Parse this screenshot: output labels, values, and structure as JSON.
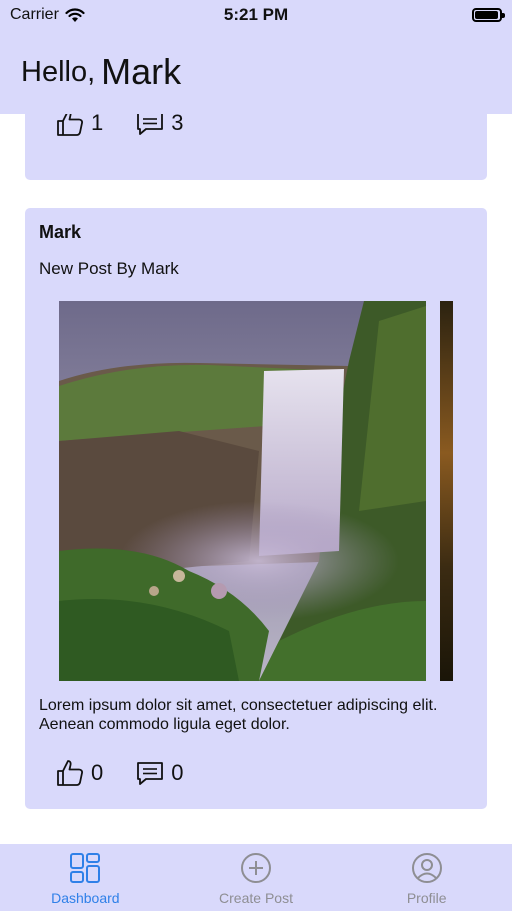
{
  "status": {
    "carrier": "Carrier",
    "time": "5:21 PM",
    "battery_level": 0.95
  },
  "header": {
    "greeting": "Hello,",
    "user_name": "Mark"
  },
  "feed": {
    "previous_post": {
      "likes": "1",
      "comments": "3"
    },
    "post": {
      "author": "Mark",
      "title": "New Post By Mark",
      "body": "Lorem ipsum dolor sit amet, consectetuer adipiscing elit. Aenean commodo ligula eget dolor.",
      "likes": "0",
      "comments": "0"
    }
  },
  "tabbar": {
    "tabs": [
      {
        "label": "Dashboard",
        "icon": "dashboard-icon",
        "active": true
      },
      {
        "label": "Create Post",
        "icon": "plus-circle-icon",
        "active": false
      },
      {
        "label": "Profile",
        "icon": "person-circle-icon",
        "active": false
      }
    ]
  },
  "colors": {
    "accent": "#2f80e8",
    "surface": "#d9d9fb",
    "inactive": "#8e8e93"
  }
}
